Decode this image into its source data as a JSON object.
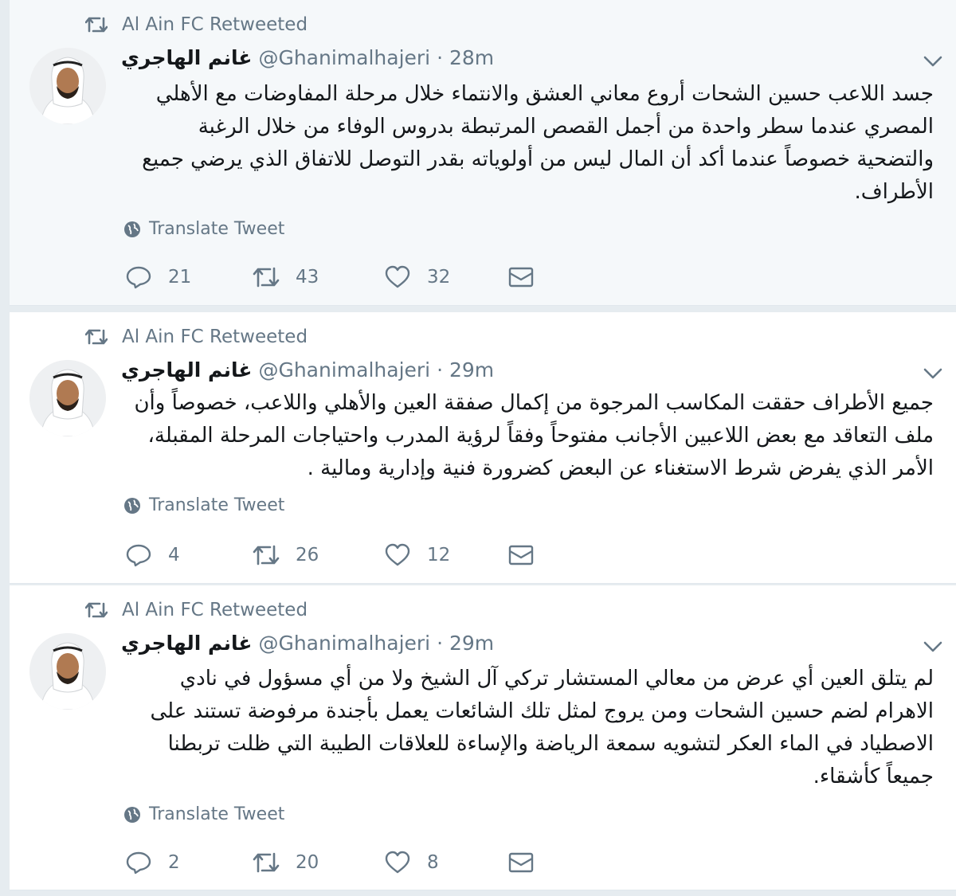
{
  "colors": {
    "meta": "#657786",
    "text": "#14171a",
    "background": "#e6ecf0",
    "card": "#ffffff",
    "card_hover": "#f5f8fa"
  },
  "tweets": [
    {
      "retweeted_by": "Al Ain FC Retweeted",
      "author_name": "غانم الهاجري",
      "handle": "@Ghanimalhajeri",
      "separator": "·",
      "time": "28m",
      "text": "جسد اللاعب حسين الشحات أروع معاني العشق والانتماء خلال مرحلة المفاوضات مع الأهلي المصري عندما سطر واحدة من أجمل القصص المرتبطة بدروس الوفاء من خلال الرغبة والتضحية خصوصاً عندما أكد أن المال ليس من أولوياته بقدر التوصل للاتفاق الذي يرضي جميع الأطراف.",
      "translate_label": "Translate Tweet",
      "replies": "21",
      "retweets": "43",
      "likes": "32"
    },
    {
      "retweeted_by": "Al Ain FC Retweeted",
      "author_name": "غانم الهاجري",
      "handle": "@Ghanimalhajeri",
      "separator": "·",
      "time": "29m",
      "text": "جميع الأطراف حققت المكاسب المرجوة من إكمال صفقة العين والأهلي واللاعب، خصوصاً وأن ملف التعاقد مع بعض اللاعبين الأجانب مفتوحاً وفقاً لرؤية المدرب واحتياجات المرحلة المقبلة، الأمر الذي يفرض شرط الاستغناء عن البعض كضرورة فنية وإدارية ومالية .",
      "translate_label": "Translate Tweet",
      "replies": "4",
      "retweets": "26",
      "likes": "12"
    },
    {
      "retweeted_by": "Al Ain FC Retweeted",
      "author_name": "غانم الهاجري",
      "handle": "@Ghanimalhajeri",
      "separator": "·",
      "time": "29m",
      "text": "لم يتلق العين أي عرض من معالي المستشار تركي آل الشيخ ولا من أي مسؤول في نادي الاهرام لضم حسين الشحات ومن يروج لمثل تلك الشائعات يعمل بأجندة مرفوضة تستند على الاصطياد في الماء العكر لتشويه سمعة الرياضة والإساءة للعلاقات الطيبة التي ظلت تربطنا جميعاً كأشقاء.",
      "translate_label": "Translate Tweet",
      "replies": "2",
      "retweets": "20",
      "likes": "8"
    }
  ],
  "icons": {
    "retweeted": "retweet-icon",
    "more": "chevron-down-icon",
    "translate": "globe-icon",
    "reply": "reply-icon",
    "retweet": "retweet-icon",
    "like": "heart-icon",
    "dm": "envelope-icon"
  }
}
